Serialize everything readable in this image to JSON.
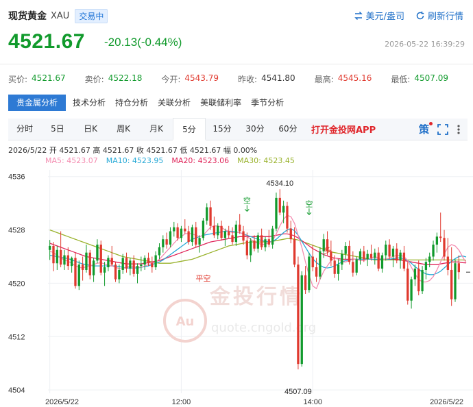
{
  "header": {
    "name": "现货黄金",
    "code": "XAU",
    "status": "交易中",
    "currency_btn": "美元/盎司",
    "refresh_btn": "刷新行情"
  },
  "price": "4521.67",
  "change": "-20.13(-0.44%)",
  "timestamp": "2026-05-22 16:39:29",
  "quotes": [
    {
      "label": "买价:",
      "value": "4521.67",
      "color": "green"
    },
    {
      "label": "卖价:",
      "value": "4522.18",
      "color": "green"
    },
    {
      "label": "今开:",
      "value": "4543.79",
      "color": "red"
    },
    {
      "label": "昨收:",
      "value": "4541.80",
      "color": "dark"
    },
    {
      "label": "最高:",
      "value": "4545.16",
      "color": "red"
    },
    {
      "label": "最低:",
      "value": "4507.09",
      "color": "green"
    }
  ],
  "analysis_tabs": [
    "贵金属分析",
    "技术分析",
    "持仓分析",
    "关联分析",
    "美联储利率",
    "季节分析"
  ],
  "period_tabs": [
    "分时",
    "5日",
    "日K",
    "周K",
    "月K",
    "5分",
    "15分",
    "30分",
    "60分"
  ],
  "active_period": 5,
  "app_link": "打开金投网APP",
  "strategy_label": "策",
  "ohlc_line": "2026/5/22  开 4521.67  高 4521.67  收 4521.67  低 4521.67  幅 0.00%",
  "ma_legend": [
    {
      "label": "MA5: 4523.07",
      "color": "#f48cb0"
    },
    {
      "label": "MA10: 4523.95",
      "color": "#27a9d6"
    },
    {
      "label": "MA20: 4523.06",
      "color": "#e0265a"
    },
    {
      "label": "MA30: 4523.45",
      "color": "#99b22c"
    }
  ],
  "watermark": {
    "brand": "金投行情",
    "url": "quote.cngold.org",
    "badge": "Au"
  },
  "colors": {
    "up": "#119a2c",
    "down": "#e0392e",
    "accent": "#2e7ad4"
  },
  "chart_data": {
    "type": "candlestick",
    "y_ticks": [
      4504,
      4512,
      4520,
      4528,
      4536
    ],
    "ylim": [
      4503.5,
      4537
    ],
    "x_tick_labels": [
      {
        "index": 0,
        "label": "2026/5/22"
      },
      {
        "index": 36,
        "label": "12:00"
      },
      {
        "index": 72,
        "label": "14:00"
      },
      {
        "index": 118,
        "label": "2026/5/22"
      }
    ],
    "max_label": {
      "value": 4534.1,
      "label": "4534.10"
    },
    "min_label": {
      "value": 4507.09,
      "label": "4507.09"
    },
    "annotations": [
      {
        "text": "空",
        "index": 54,
        "value": 4531.0,
        "color": "green"
      },
      {
        "text": "空",
        "index": 71,
        "value": 4530.5,
        "color": "green"
      },
      {
        "text": "空",
        "index": 127,
        "value": 4528.5,
        "color": "green"
      },
      {
        "text": "多",
        "index": 76,
        "value": 4525.4,
        "color": "red"
      },
      {
        "text": "多",
        "index": 122,
        "value": 4521.0,
        "color": "red"
      },
      {
        "text": "平空",
        "index": 42,
        "value": 4521.2,
        "color": "red"
      }
    ],
    "candles": [
      [
        4525.0,
        4526.5,
        4523.5,
        4525.6
      ],
      [
        4525.6,
        4526.2,
        4521.8,
        4523.0
      ],
      [
        4523.0,
        4525.6,
        4522.0,
        4525.0
      ],
      [
        4525.0,
        4527.8,
        4522.4,
        4522.8
      ],
      [
        4522.8,
        4525.0,
        4522.0,
        4524.2
      ],
      [
        4524.2,
        4525.4,
        4522.0,
        4522.6
      ],
      [
        4522.6,
        4524.0,
        4521.6,
        4523.8
      ],
      [
        4523.8,
        4524.6,
        4519.2,
        4519.6
      ],
      [
        4519.6,
        4523.4,
        4519.0,
        4522.8
      ],
      [
        4522.8,
        4524.0,
        4520.4,
        4522.0
      ],
      [
        4522.0,
        4525.8,
        4521.6,
        4524.6
      ],
      [
        4524.6,
        4525.0,
        4520.6,
        4521.2
      ],
      [
        4521.2,
        4523.8,
        4520.2,
        4523.4
      ],
      [
        4523.4,
        4526.6,
        4523.0,
        4525.8
      ],
      [
        4525.8,
        4526.4,
        4521.2,
        4521.6
      ],
      [
        4521.6,
        4523.2,
        4519.6,
        4522.4
      ],
      [
        4522.4,
        4524.2,
        4521.8,
        4523.8
      ],
      [
        4523.8,
        4525.6,
        4522.6,
        4522.8
      ],
      [
        4522.8,
        4523.2,
        4520.2,
        4520.6
      ],
      [
        4520.6,
        4522.8,
        4520.0,
        4522.0
      ],
      [
        4522.0,
        4524.4,
        4521.4,
        4523.8
      ],
      [
        4523.8,
        4524.6,
        4521.6,
        4522.2
      ],
      [
        4522.2,
        4523.8,
        4521.2,
        4523.4
      ],
      [
        4523.4,
        4524.2,
        4521.0,
        4521.4
      ],
      [
        4521.4,
        4523.0,
        4520.0,
        4522.6
      ],
      [
        4522.6,
        4524.0,
        4521.8,
        4522.8
      ],
      [
        4522.8,
        4524.2,
        4522.0,
        4523.8
      ],
      [
        4523.8,
        4524.6,
        4522.6,
        4523.0
      ],
      [
        4523.0,
        4524.0,
        4521.6,
        4522.4
      ],
      [
        4522.4,
        4524.8,
        4522.0,
        4524.2
      ],
      [
        4524.2,
        4526.0,
        4523.6,
        4525.4
      ],
      [
        4525.4,
        4527.2,
        4524.6,
        4526.6
      ],
      [
        4526.6,
        4527.6,
        4525.2,
        4525.8
      ],
      [
        4525.8,
        4528.4,
        4525.4,
        4527.8
      ],
      [
        4527.8,
        4529.2,
        4527.0,
        4528.4
      ],
      [
        4528.4,
        4529.0,
        4526.4,
        4526.8
      ],
      [
        4526.8,
        4528.6,
        4526.2,
        4528.2
      ],
      [
        4528.2,
        4529.6,
        4527.4,
        4527.8
      ],
      [
        4527.8,
        4528.6,
        4525.8,
        4526.2
      ],
      [
        4526.2,
        4528.8,
        4525.6,
        4528.4
      ],
      [
        4528.4,
        4529.2,
        4525.4,
        4525.8
      ],
      [
        4525.8,
        4527.2,
        4524.6,
        4526.8
      ],
      [
        4526.8,
        4529.8,
        4526.4,
        4529.4
      ],
      [
        4529.4,
        4532.0,
        4528.8,
        4531.4
      ],
      [
        4531.4,
        4532.4,
        4528.0,
        4528.6
      ],
      [
        4528.6,
        4530.0,
        4526.8,
        4527.2
      ],
      [
        4527.2,
        4529.0,
        4526.6,
        4528.6
      ],
      [
        4528.6,
        4529.4,
        4526.4,
        4526.8
      ],
      [
        4526.8,
        4528.2,
        4525.6,
        4527.8
      ],
      [
        4527.8,
        4528.6,
        4526.8,
        4527.2
      ],
      [
        4527.2,
        4528.4,
        4525.8,
        4526.2
      ],
      [
        4526.2,
        4529.4,
        4525.6,
        4528.8
      ],
      [
        4528.8,
        4530.4,
        4527.4,
        4527.8
      ],
      [
        4527.8,
        4528.6,
        4525.8,
        4526.4
      ],
      [
        4526.4,
        4527.6,
        4523.6,
        4524.2
      ],
      [
        4524.2,
        4526.8,
        4523.2,
        4526.4
      ],
      [
        4526.4,
        4527.2,
        4524.8,
        4525.2
      ],
      [
        4525.2,
        4527.6,
        4524.6,
        4527.2
      ],
      [
        4527.2,
        4528.2,
        4525.0,
        4525.4
      ],
      [
        4525.4,
        4527.0,
        4524.8,
        4526.6
      ],
      [
        4526.6,
        4528.0,
        4525.4,
        4525.8
      ],
      [
        4525.8,
        4528.6,
        4525.2,
        4528.2
      ],
      [
        4528.2,
        4533.6,
        4527.8,
        4532.8
      ],
      [
        4532.8,
        4534.1,
        4530.2,
        4530.6
      ],
      [
        4530.6,
        4532.4,
        4529.0,
        4531.6
      ],
      [
        4531.6,
        4532.2,
        4527.6,
        4528.2
      ],
      [
        4528.2,
        4529.4,
        4526.0,
        4526.6
      ],
      [
        4526.6,
        4528.4,
        4522.4,
        4522.8
      ],
      [
        4522.8,
        4524.0,
        4507.09,
        4507.9
      ],
      [
        4507.9,
        4521.8,
        4507.5,
        4521.2
      ],
      [
        4521.2,
        4522.6,
        4518.4,
        4519.0
      ],
      [
        4519.0,
        4524.6,
        4518.6,
        4524.0
      ],
      [
        4524.0,
        4525.8,
        4521.8,
        4522.4
      ],
      [
        4522.4,
        4523.8,
        4520.2,
        4521.0
      ],
      [
        4521.0,
        4525.4,
        4520.6,
        4524.8
      ],
      [
        4524.8,
        4527.4,
        4523.8,
        4526.6
      ],
      [
        4526.6,
        4527.8,
        4524.2,
        4524.8
      ],
      [
        4524.8,
        4526.4,
        4522.6,
        4523.4
      ],
      [
        4523.4,
        4524.2,
        4520.8,
        4521.4
      ],
      [
        4521.4,
        4523.6,
        4520.4,
        4522.8
      ],
      [
        4522.8,
        4525.0,
        4522.0,
        4524.4
      ],
      [
        4524.4,
        4526.2,
        4523.6,
        4525.6
      ],
      [
        4525.6,
        4526.4,
        4522.8,
        4523.2
      ],
      [
        4523.2,
        4524.8,
        4521.0,
        4521.6
      ],
      [
        4521.6,
        4524.0,
        4521.2,
        4523.6
      ],
      [
        4523.6,
        4525.2,
        4522.8,
        4524.8
      ],
      [
        4524.8,
        4525.6,
        4523.2,
        4523.6
      ],
      [
        4523.6,
        4525.0,
        4522.6,
        4524.4
      ],
      [
        4524.4,
        4525.8,
        4523.4,
        4523.8
      ],
      [
        4523.8,
        4525.2,
        4522.8,
        4524.6
      ],
      [
        4524.6,
        4525.4,
        4521.8,
        4522.2
      ],
      [
        4522.2,
        4524.6,
        4521.6,
        4524.2
      ],
      [
        4524.2,
        4526.4,
        4523.4,
        4525.8
      ],
      [
        4525.8,
        4526.6,
        4523.6,
        4524.0
      ],
      [
        4524.0,
        4525.6,
        4522.4,
        4525.2
      ],
      [
        4525.2,
        4526.0,
        4523.0,
        4523.4
      ],
      [
        4523.4,
        4525.0,
        4522.2,
        4524.6
      ],
      [
        4524.6,
        4525.6,
        4521.8,
        4522.2
      ],
      [
        4522.2,
        4523.2,
        4516.8,
        4517.4
      ],
      [
        4517.4,
        4521.0,
        4516.2,
        4520.6
      ],
      [
        4520.6,
        4522.8,
        4519.6,
        4522.2
      ],
      [
        4522.2,
        4523.4,
        4518.2,
        4518.8
      ],
      [
        4518.8,
        4522.6,
        4518.4,
        4522.0
      ],
      [
        4522.0,
        4523.8,
        4520.6,
        4523.2
      ],
      [
        4523.2,
        4524.6,
        4522.4,
        4524.0
      ],
      [
        4524.0,
        4526.4,
        4523.4,
        4525.8
      ],
      [
        4525.8,
        4527.6,
        4524.6,
        4527.0
      ],
      [
        4527.0,
        4530.6,
        4526.2,
        4526.8
      ],
      [
        4526.8,
        4528.0,
        4523.4,
        4524.0
      ],
      [
        4524.0,
        4526.8,
        4521.2,
        4522.0
      ],
      [
        4522.0,
        4525.4,
        4516.6,
        4517.6
      ],
      [
        4517.6,
        4523.6,
        4517.2,
        4523.0
      ],
      [
        4523.0,
        4524.2,
        4520.6,
        4521.67
      ]
    ],
    "ma5": [
      4524.8,
      4524.6,
      4524.2,
      4523.8,
      4523.5,
      4523.3,
      4523.0,
      4522.6,
      4522.4,
      4522.3,
      4522.5,
      4522.6,
      4522.8,
      4523.0,
      4523.1,
      4522.9,
      4522.7,
      4522.6,
      4522.4,
      4522.2,
      4522.2,
      4522.4,
      4522.6,
      4522.5,
      4522.4,
      4522.4,
      4522.6,
      4522.8,
      4523.0,
      4523.2,
      4523.6,
      4524.2,
      4524.8,
      4525.4,
      4526.0,
      4526.6,
      4527.0,
      4527.4,
      4527.5,
      4527.4,
      4527.2,
      4527.0,
      4527.2,
      4527.8,
      4528.4,
      4528.6,
      4528.6,
      4528.4,
      4528.0,
      4527.8,
      4527.6,
      4527.6,
      4527.6,
      4527.4,
      4527.0,
      4526.6,
      4526.2,
      4526.0,
      4525.8,
      4525.9,
      4526.0,
      4526.4,
      4527.4,
      4528.6,
      4529.6,
      4530.2,
      4530.0,
      4529.0,
      4527.2,
      4525.4,
      4523.2,
      4521.2,
      4519.6,
      4519.2,
      4520.6,
      4521.8,
      4522.6,
      4523.4,
      4523.8,
      4523.6,
      4523.2,
      4523.2,
      4523.4,
      4523.6,
      4523.6,
      4523.4,
      4523.4,
      4523.6,
      4523.8,
      4524.0,
      4523.8,
      4523.6,
      4523.6,
      4523.8,
      4524.0,
      4524.2,
      4524.2,
      4524.0,
      4523.4,
      4522.4,
      4521.4,
      4520.6,
      4520.2,
      4520.2,
      4520.4,
      4521.0,
      4522.0,
      4523.2,
      4524.4,
      4525.4,
      4525.8,
      4525.6,
      4525.0,
      4524.0,
      4523.07
    ],
    "ma10": [
      4524.2,
      4524.1,
      4524.0,
      4523.9,
      4523.8,
      4523.7,
      4523.5,
      4523.3,
      4523.1,
      4522.9,
      4522.8,
      4522.7,
      4522.6,
      4522.6,
      4522.6,
      4522.6,
      4522.6,
      4522.6,
      4522.6,
      4522.5,
      4522.4,
      4522.3,
      4522.3,
      4522.3,
      4522.3,
      4522.4,
      4522.5,
      4522.6,
      4522.8,
      4523.0,
      4523.2,
      4523.5,
      4523.9,
      4524.3,
      4524.7,
      4525.1,
      4525.5,
      4525.9,
      4526.3,
      4526.6,
      4526.8,
      4527.0,
      4527.2,
      4527.3,
      4527.4,
      4527.5,
      4527.6,
      4527.7,
      4527.8,
      4527.8,
      4527.8,
      4527.7,
      4527.6,
      4527.4,
      4527.2,
      4527.0,
      4526.8,
      4526.6,
      4526.4,
      4526.3,
      4526.2,
      4526.3,
      4526.6,
      4527.1,
      4527.6,
      4528.0,
      4528.2,
      4527.9,
      4527.2,
      4526.3,
      4525.4,
      4524.5,
      4523.7,
      4523.1,
      4522.7,
      4522.4,
      4522.3,
      4522.4,
      4522.6,
      4522.9,
      4523.2,
      4523.4,
      4523.5,
      4523.6,
      4523.6,
      4523.6,
      4523.6,
      4523.6,
      4523.6,
      4523.6,
      4523.6,
      4523.6,
      4523.6,
      4523.6,
      4523.7,
      4523.8,
      4523.8,
      4523.7,
      4523.4,
      4523.0,
      4522.5,
      4522.1,
      4521.7,
      4521.4,
      4521.3,
      4521.3,
      4521.5,
      4521.8,
      4522.3,
      4522.8,
      4523.3,
      4523.7,
      4524.0,
      4524.1,
      4523.95
    ],
    "ma20": [
      4526.0,
      4525.8,
      4525.6,
      4525.4,
      4525.2,
      4525.0,
      4524.8,
      4524.6,
      4524.4,
      4524.2,
      4524.0,
      4523.9,
      4523.8,
      4523.7,
      4523.6,
      4523.5,
      4523.4,
      4523.3,
      4523.2,
      4523.1,
      4523.0,
      4522.9,
      4522.9,
      4522.9,
      4522.9,
      4522.9,
      4523.0,
      4523.1,
      4523.2,
      4523.3,
      4523.4,
      4523.6,
      4523.8,
      4524.0,
      4524.2,
      4524.4,
      4524.6,
      4524.8,
      4525.0,
      4525.2,
      4525.4,
      4525.6,
      4525.8,
      4526.0,
      4526.2,
      4526.3,
      4526.4,
      4526.5,
      4526.6,
      4526.7,
      4526.8,
      4526.9,
      4527.0,
      4527.0,
      4527.0,
      4527.0,
      4527.0,
      4527.0,
      4527.0,
      4527.0,
      4527.0,
      4527.1,
      4527.2,
      4527.3,
      4527.4,
      4527.4,
      4527.3,
      4527.1,
      4526.8,
      4526.4,
      4526.0,
      4525.6,
      4525.2,
      4524.9,
      4524.6,
      4524.3,
      4524.1,
      4523.9,
      4523.8,
      4523.7,
      4523.6,
      4523.6,
      4523.6,
      4523.6,
      4523.6,
      4523.6,
      4523.6,
      4523.6,
      4523.6,
      4523.6,
      4523.6,
      4523.6,
      4523.6,
      4523.6,
      4523.6,
      4523.6,
      4523.5,
      4523.4,
      4523.3,
      4523.2,
      4523.1,
      4523.0,
      4522.9,
      4522.8,
      4522.8,
      4522.8,
      4522.8,
      4522.9,
      4523.0,
      4523.1,
      4523.2,
      4523.2,
      4523.2,
      4523.1,
      4523.06
    ],
    "ma30": [
      4528.0,
      4527.8,
      4527.6,
      4527.4,
      4527.2,
      4527.0,
      4526.8,
      4526.6,
      4526.4,
      4526.2,
      4526.0,
      4525.8,
      4525.6,
      4525.4,
      4525.2,
      4525.0,
      4524.8,
      4524.6,
      4524.4,
      4524.2,
      4524.0,
      4523.9,
      4523.8,
      4523.7,
      4523.6,
      4523.5,
      4523.4,
      4523.3,
      4523.2,
      4523.1,
      4523.0,
      4523.0,
      4523.0,
      4523.0,
      4523.1,
      4523.2,
      4523.3,
      4523.4,
      4523.5,
      4523.6,
      4523.8,
      4524.0,
      4524.2,
      4524.4,
      4524.6,
      4524.8,
      4525.0,
      4525.2,
      4525.4,
      4525.6,
      4525.7,
      4525.8,
      4525.9,
      4526.0,
      4526.1,
      4526.2,
      4526.2,
      4526.2,
      4526.2,
      4526.2,
      4526.2,
      4526.3,
      4526.4,
      4526.5,
      4526.6,
      4526.7,
      4526.7,
      4526.6,
      4526.5,
      4526.3,
      4526.1,
      4525.9,
      4525.7,
      4525.5,
      4525.3,
      4525.1,
      4524.9,
      4524.7,
      4524.6,
      4524.5,
      4524.4,
      4524.3,
      4524.2,
      4524.1,
      4524.0,
      4523.9,
      4523.8,
      4523.7,
      4523.6,
      4523.5,
      4523.5,
      4523.5,
      4523.5,
      4523.5,
      4523.5,
      4523.5,
      4523.5,
      4523.5,
      4523.5,
      4523.5,
      4523.5,
      4523.5,
      4523.5,
      4523.5,
      4523.5,
      4523.5,
      4523.5,
      4523.5,
      4523.5,
      4523.5,
      4523.5,
      4523.5,
      4523.5,
      4523.5,
      4523.45
    ]
  }
}
